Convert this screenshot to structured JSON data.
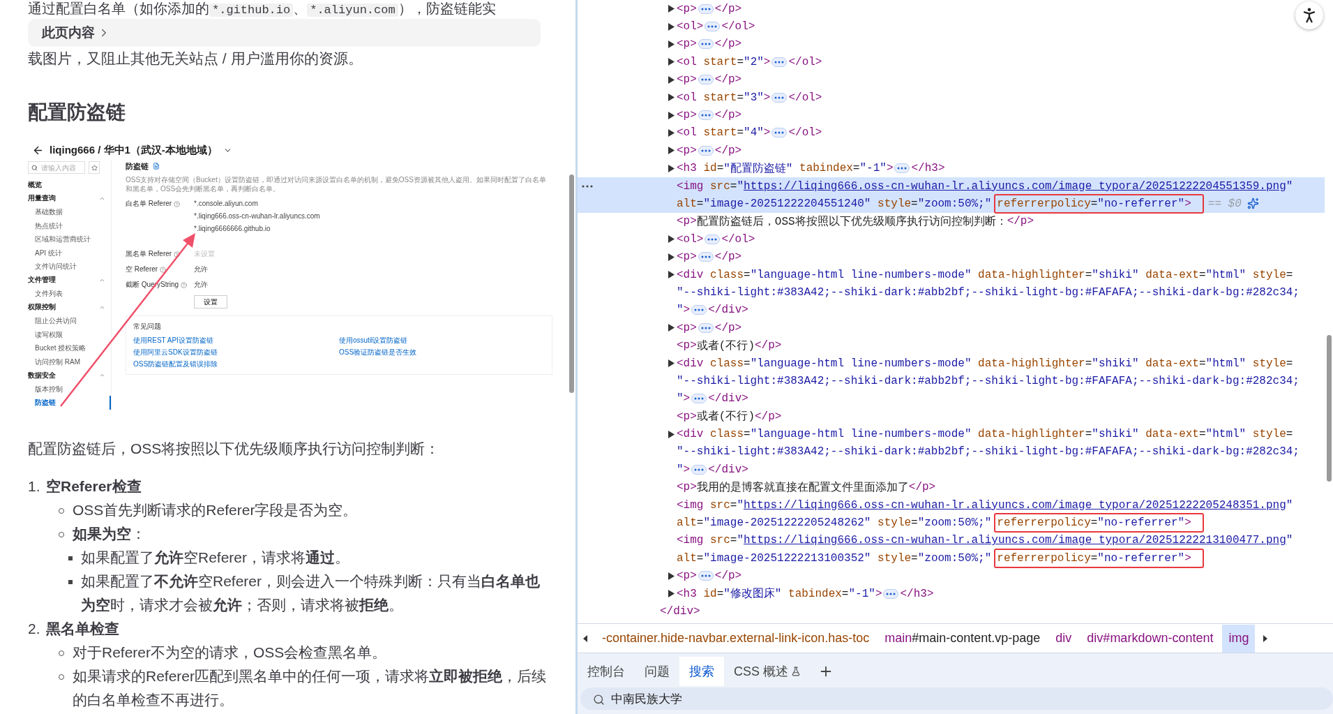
{
  "article": {
    "intro_cut": {
      "parts": [
        {
          "kind": "text",
          "t": "通过配置白名单（如你添加的"
        },
        {
          "kind": "code",
          "t": "*.github.io"
        },
        {
          "kind": "text",
          "t": "、"
        },
        {
          "kind": "code",
          "t": "*.aliyun.com"
        },
        {
          "kind": "text",
          "t": "），防盗链能实"
        }
      ]
    },
    "toc": "此页内容",
    "intro_end": "载图片，又阻止其他无关站点 / 用户滥用你的资源。",
    "heading": "配置防盗链",
    "screenshot": {
      "title": "liqing666 / 华中1（武汉-本地地域）",
      "search": {
        "placeholder": "请输入内容"
      },
      "nav": [
        {
          "kind": "link",
          "label": "概览"
        },
        {
          "kind": "group",
          "label": "用量查询",
          "expanded": true,
          "items": [
            {
              "label": "基础数据",
              "selected": false
            },
            {
              "label": "热点统计",
              "selected": false
            },
            {
              "label": "区域和运营商统计",
              "selected": false
            },
            {
              "label": "API 统计",
              "selected": false
            },
            {
              "label": "文件访问统计",
              "selected": false
            }
          ]
        },
        {
          "kind": "group",
          "label": "文件管理",
          "expanded": true,
          "items": [
            {
              "label": "文件列表",
              "selected": false
            }
          ]
        },
        {
          "kind": "group",
          "label": "权限控制",
          "expanded": true,
          "items": [
            {
              "label": "阻止公共访问",
              "selected": false
            },
            {
              "label": "读写权限",
              "selected": false
            },
            {
              "label": "Bucket 授权策略",
              "selected": false
            },
            {
              "label": "访问控制 RAM",
              "selected": false
            }
          ]
        },
        {
          "kind": "group",
          "label": "数据安全",
          "expanded": true,
          "items": [
            {
              "label": "版本控制",
              "selected": false
            },
            {
              "label": "防盗链",
              "selected": true
            }
          ]
        }
      ],
      "heading": "防盗链",
      "description": "OSS支持对存储空间（Bucket）设置防盗链，即通过对访问来源设置白名单的机制，避免OSS资源被其他人盗用。如果同时配置了白名单和黑名单，OSS会先判断黑名单，再判断白名单。",
      "fields": [
        {
          "label": "白名单 Referer",
          "muted": false,
          "values": [
            "*.console.aliyun.com",
            "*.liqing666.oss-cn-wuhan-lr.aliyuncs.com",
            "*.liqing6666666.github.io"
          ]
        },
        {
          "label": "黑名单 Referer",
          "muted": true,
          "values": [
            "未设置"
          ]
        },
        {
          "label": "空 Referer",
          "muted": false,
          "values": [
            "允许"
          ]
        },
        {
          "label": "截断 QueryString",
          "muted": false,
          "values": [
            "允许"
          ]
        }
      ],
      "button": "设置",
      "faq": {
        "title": "常见问题",
        "links": [
          "使用REST API设置防盗链",
          "使用ossutil设置防盗链",
          "使用阿里云SDK设置防盗链",
          "OSS验证防盗链是否生效",
          "OSS防盗链配置及错误排除"
        ]
      }
    },
    "paragraph": "配置防盗链后，OSS将按照以下优先级顺序执行访问控制判断：",
    "list": [
      {
        "number": "1.",
        "title": "空Referer检查",
        "children": [
          {
            "text": "OSS首先判断请求的Referer字段是否为空。"
          },
          {
            "text": "**如果为空**：",
            "children": [
              {
                "text": "如果配置了**允许**空Referer，请求将**通过**。"
              },
              {
                "text": "如果配置了**不允许**空Referer，则会进入一个特殊判断：只有当**白名单也为空**时，请求才会被**允许**；否则，请求将被**拒绝**。"
              }
            ]
          }
        ]
      },
      {
        "number": "2.",
        "title": "黑名单检查",
        "children": [
          {
            "text": "对于Referer不为空的请求，OSS会检查黑名单。"
          },
          {
            "text": "如果请求的Referer匹配到黑名单中的任何一项，请求将**立即被拒绝**，后续的白名单检查不再进行。"
          }
        ]
      }
    ]
  },
  "elements": {
    "nodes": [
      {
        "expandable": true,
        "selected": false,
        "lines": [
          [
            {
              "kind": "tag",
              "t": "<p>"
            },
            {
              "kind": "more"
            },
            {
              "kind": "tag",
              "t": "</p>"
            }
          ]
        ]
      },
      {
        "expandable": true,
        "selected": false,
        "lines": [
          [
            {
              "kind": "tag",
              "t": "<ol>"
            },
            {
              "kind": "more"
            },
            {
              "kind": "tag",
              "t": "</ol>"
            }
          ]
        ]
      },
      {
        "expandable": true,
        "selected": false,
        "lines": [
          [
            {
              "kind": "tag",
              "t": "<p>"
            },
            {
              "kind": "more"
            },
            {
              "kind": "tag",
              "t": "</p>"
            }
          ]
        ]
      },
      {
        "expandable": true,
        "selected": false,
        "lines": [
          [
            {
              "kind": "tag",
              "t": "<ol"
            },
            {
              "kind": "attr",
              "t": " start"
            },
            {
              "kind": "text",
              "t": "="
            },
            {
              "kind": "val",
              "t": "\"2\""
            },
            {
              "kind": "tag",
              "t": ">"
            },
            {
              "kind": "more"
            },
            {
              "kind": "tag",
              "t": "</ol>"
            }
          ]
        ]
      },
      {
        "expandable": true,
        "selected": false,
        "lines": [
          [
            {
              "kind": "tag",
              "t": "<p>"
            },
            {
              "kind": "more"
            },
            {
              "kind": "tag",
              "t": "</p>"
            }
          ]
        ]
      },
      {
        "expandable": true,
        "selected": false,
        "lines": [
          [
            {
              "kind": "tag",
              "t": "<ol"
            },
            {
              "kind": "attr",
              "t": " start"
            },
            {
              "kind": "text",
              "t": "="
            },
            {
              "kind": "val",
              "t": "\"3\""
            },
            {
              "kind": "tag",
              "t": ">"
            },
            {
              "kind": "more"
            },
            {
              "kind": "tag",
              "t": "</ol>"
            }
          ]
        ]
      },
      {
        "expandable": true,
        "selected": false,
        "lines": [
          [
            {
              "kind": "tag",
              "t": "<p>"
            },
            {
              "kind": "more"
            },
            {
              "kind": "tag",
              "t": "</p>"
            }
          ]
        ]
      },
      {
        "expandable": true,
        "selected": false,
        "lines": [
          [
            {
              "kind": "tag",
              "t": "<ol"
            },
            {
              "kind": "attr",
              "t": " start"
            },
            {
              "kind": "text",
              "t": "="
            },
            {
              "kind": "val",
              "t": "\"4\""
            },
            {
              "kind": "tag",
              "t": ">"
            },
            {
              "kind": "more"
            },
            {
              "kind": "tag",
              "t": "</ol>"
            }
          ]
        ]
      },
      {
        "expandable": true,
        "selected": false,
        "lines": [
          [
            {
              "kind": "tag",
              "t": "<p>"
            },
            {
              "kind": "more"
            },
            {
              "kind": "tag",
              "t": "</p>"
            }
          ]
        ]
      },
      {
        "expandable": true,
        "selected": false,
        "lines": [
          [
            {
              "kind": "tag",
              "t": "<h3"
            },
            {
              "kind": "attr",
              "t": " id"
            },
            {
              "kind": "text",
              "t": "="
            },
            {
              "kind": "val",
              "t": "\"配置防盗链\""
            },
            {
              "kind": "attr",
              "t": " tabindex"
            },
            {
              "kind": "text",
              "t": "="
            },
            {
              "kind": "val",
              "t": "\"-1\""
            },
            {
              "kind": "tag",
              "t": ">"
            },
            {
              "kind": "more"
            },
            {
              "kind": "tag",
              "t": "</h3>"
            }
          ]
        ]
      },
      {
        "expandable": false,
        "selected": true,
        "lines": [
          [
            {
              "kind": "tag",
              "t": "<img"
            },
            {
              "kind": "attr",
              "t": " src"
            },
            {
              "kind": "text",
              "t": "="
            },
            {
              "kind": "val",
              "t": "\""
            },
            {
              "kind": "link",
              "t": "https://liqing666.oss-cn-wuhan-lr.aliyuncs.com/image_typora/20251222204551359.png"
            },
            {
              "kind": "val",
              "t": "\""
            }
          ],
          [
            {
              "kind": "attr",
              "t": "alt"
            },
            {
              "kind": "text",
              "t": "="
            },
            {
              "kind": "val",
              "t": "\"image-20251222204551240\""
            },
            {
              "kind": "attr",
              "t": " style"
            },
            {
              "kind": "text",
              "t": "="
            },
            {
              "kind": "val",
              "t": "\"zoom:50%;\""
            },
            {
              "kind": "box",
              "parts": [
                {
                  "kind": "attr",
                  "t": "referrerpolicy"
                },
                {
                  "kind": "text",
                  "t": "="
                },
                {
                  "kind": "val",
                  "t": "\"no-referrer\""
                },
                {
                  "kind": "tag",
                  "t": ">"
                }
              ]
            },
            {
              "kind": "dim",
              "t": "== $0"
            },
            {
              "kind": "ai"
            }
          ]
        ]
      },
      {
        "expandable": false,
        "selected": false,
        "lines": [
          [
            {
              "kind": "tag",
              "t": "<p>"
            },
            {
              "kind": "text",
              "t": "配置防盗链后，OSS将按照以下优先级顺序执行访问控制判断："
            },
            {
              "kind": "tag",
              "t": "</p>"
            }
          ]
        ]
      },
      {
        "expandable": true,
        "selected": false,
        "lines": [
          [
            {
              "kind": "tag",
              "t": "<ol>"
            },
            {
              "kind": "more"
            },
            {
              "kind": "tag",
              "t": "</ol>"
            }
          ]
        ]
      },
      {
        "expandable": true,
        "selected": false,
        "lines": [
          [
            {
              "kind": "tag",
              "t": "<p>"
            },
            {
              "kind": "more"
            },
            {
              "kind": "tag",
              "t": "</p>"
            }
          ]
        ]
      },
      {
        "expandable": true,
        "selected": false,
        "lines": [
          [
            {
              "kind": "tag",
              "t": "<div"
            },
            {
              "kind": "attr",
              "t": " class"
            },
            {
              "kind": "text",
              "t": "="
            },
            {
              "kind": "val",
              "t": "\"language-html line-numbers-mode\""
            },
            {
              "kind": "attr",
              "t": " data-highlighter"
            },
            {
              "kind": "text",
              "t": "="
            },
            {
              "kind": "val",
              "t": "\"shiki\""
            },
            {
              "kind": "attr",
              "t": " data-ext"
            },
            {
              "kind": "text",
              "t": "="
            },
            {
              "kind": "val",
              "t": "\"html\""
            },
            {
              "kind": "attr",
              "t": " style"
            },
            {
              "kind": "text",
              "t": "="
            }
          ],
          [
            {
              "kind": "val",
              "t": "\"--shiki-light:#383A42;--shiki-dark:#abb2bf;--shiki-light-bg:#FAFAFA;--shiki-dark-bg:#282c34;"
            }
          ],
          [
            {
              "kind": "val",
              "t": "\""
            },
            {
              "kind": "tag",
              "t": ">"
            },
            {
              "kind": "more"
            },
            {
              "kind": "tag",
              "t": "</div>"
            }
          ]
        ]
      },
      {
        "expandable": true,
        "selected": false,
        "lines": [
          [
            {
              "kind": "tag",
              "t": "<p>"
            },
            {
              "kind": "more"
            },
            {
              "kind": "tag",
              "t": "</p>"
            }
          ]
        ]
      },
      {
        "expandable": false,
        "selected": false,
        "lines": [
          [
            {
              "kind": "tag",
              "t": "<p>"
            },
            {
              "kind": "text",
              "t": "或者(不行)"
            },
            {
              "kind": "tag",
              "t": "</p>"
            }
          ]
        ]
      },
      {
        "expandable": true,
        "selected": false,
        "lines": [
          [
            {
              "kind": "tag",
              "t": "<div"
            },
            {
              "kind": "attr",
              "t": " class"
            },
            {
              "kind": "text",
              "t": "="
            },
            {
              "kind": "val",
              "t": "\"language-html line-numbers-mode\""
            },
            {
              "kind": "attr",
              "t": " data-highlighter"
            },
            {
              "kind": "text",
              "t": "="
            },
            {
              "kind": "val",
              "t": "\"shiki\""
            },
            {
              "kind": "attr",
              "t": " data-ext"
            },
            {
              "kind": "text",
              "t": "="
            },
            {
              "kind": "val",
              "t": "\"html\""
            },
            {
              "kind": "attr",
              "t": " style"
            },
            {
              "kind": "text",
              "t": "="
            }
          ],
          [
            {
              "kind": "val",
              "t": "\"--shiki-light:#383A42;--shiki-dark:#abb2bf;--shiki-light-bg:#FAFAFA;--shiki-dark-bg:#282c34;"
            }
          ],
          [
            {
              "kind": "val",
              "t": "\""
            },
            {
              "kind": "tag",
              "t": ">"
            },
            {
              "kind": "more"
            },
            {
              "kind": "tag",
              "t": "</div>"
            }
          ]
        ]
      },
      {
        "expandable": false,
        "selected": false,
        "lines": [
          [
            {
              "kind": "tag",
              "t": "<p>"
            },
            {
              "kind": "text",
              "t": "或者(不行)"
            },
            {
              "kind": "tag",
              "t": "</p>"
            }
          ]
        ]
      },
      {
        "expandable": true,
        "selected": false,
        "lines": [
          [
            {
              "kind": "tag",
              "t": "<div"
            },
            {
              "kind": "attr",
              "t": " class"
            },
            {
              "kind": "text",
              "t": "="
            },
            {
              "kind": "val",
              "t": "\"language-html line-numbers-mode\""
            },
            {
              "kind": "attr",
              "t": " data-highlighter"
            },
            {
              "kind": "text",
              "t": "="
            },
            {
              "kind": "val",
              "t": "\"shiki\""
            },
            {
              "kind": "attr",
              "t": " data-ext"
            },
            {
              "kind": "text",
              "t": "="
            },
            {
              "kind": "val",
              "t": "\"html\""
            },
            {
              "kind": "attr",
              "t": " style"
            },
            {
              "kind": "text",
              "t": "="
            }
          ],
          [
            {
              "kind": "val",
              "t": "\"--shiki-light:#383A42;--shiki-dark:#abb2bf;--shiki-light-bg:#FAFAFA;--shiki-dark-bg:#282c34;"
            }
          ],
          [
            {
              "kind": "val",
              "t": "\""
            },
            {
              "kind": "tag",
              "t": ">"
            },
            {
              "kind": "more"
            },
            {
              "kind": "tag",
              "t": "</div>"
            }
          ]
        ]
      },
      {
        "expandable": false,
        "selected": false,
        "lines": [
          [
            {
              "kind": "tag",
              "t": "<p>"
            },
            {
              "kind": "text",
              "t": "我用的是博客就直接在配置文件里面添加了"
            },
            {
              "kind": "tag",
              "t": "</p>"
            }
          ]
        ]
      },
      {
        "expandable": false,
        "selected": false,
        "lines": [
          [
            {
              "kind": "tag",
              "t": "<img"
            },
            {
              "kind": "attr",
              "t": " src"
            },
            {
              "kind": "text",
              "t": "="
            },
            {
              "kind": "val",
              "t": "\""
            },
            {
              "kind": "link",
              "t": "https://liqing666.oss-cn-wuhan-lr.aliyuncs.com/image_typora/20251222205248351.png"
            },
            {
              "kind": "val",
              "t": "\""
            }
          ],
          [
            {
              "kind": "attr",
              "t": "alt"
            },
            {
              "kind": "text",
              "t": "="
            },
            {
              "kind": "val",
              "t": "\"image-20251222205248262\""
            },
            {
              "kind": "attr",
              "t": " style"
            },
            {
              "kind": "text",
              "t": "="
            },
            {
              "kind": "val",
              "t": "\"zoom:50%;\""
            },
            {
              "kind": "box",
              "parts": [
                {
                  "kind": "attr",
                  "t": "referrerpolicy"
                },
                {
                  "kind": "text",
                  "t": "="
                },
                {
                  "kind": "val",
                  "t": "\"no-referrer\""
                },
                {
                  "kind": "tag",
                  "t": ">"
                }
              ]
            }
          ]
        ]
      },
      {
        "expandable": false,
        "selected": false,
        "lines": [
          [
            {
              "kind": "tag",
              "t": "<img"
            },
            {
              "kind": "attr",
              "t": " src"
            },
            {
              "kind": "text",
              "t": "="
            },
            {
              "kind": "val",
              "t": "\""
            },
            {
              "kind": "link",
              "t": "https://liqing666.oss-cn-wuhan-lr.aliyuncs.com/image_typora/20251222213100477.png"
            },
            {
              "kind": "val",
              "t": "\""
            }
          ],
          [
            {
              "kind": "attr",
              "t": "alt"
            },
            {
              "kind": "text",
              "t": "="
            },
            {
              "kind": "val",
              "t": "\"image-20251222213100352\""
            },
            {
              "kind": "attr",
              "t": " style"
            },
            {
              "kind": "text",
              "t": "="
            },
            {
              "kind": "val",
              "t": "\"zoom:50%;\""
            },
            {
              "kind": "box",
              "parts": [
                {
                  "kind": "attr",
                  "t": "referrerpolicy"
                },
                {
                  "kind": "text",
                  "t": "="
                },
                {
                  "kind": "val",
                  "t": "\"no-referrer\""
                },
                {
                  "kind": "tag",
                  "t": ">"
                }
              ]
            }
          ]
        ]
      },
      {
        "expandable": true,
        "selected": false,
        "lines": [
          [
            {
              "kind": "tag",
              "t": "<p>"
            },
            {
              "kind": "more"
            },
            {
              "kind": "tag",
              "t": "</p>"
            }
          ]
        ]
      },
      {
        "expandable": true,
        "selected": false,
        "lines": [
          [
            {
              "kind": "tag",
              "t": "<h3"
            },
            {
              "kind": "attr",
              "t": " id"
            },
            {
              "kind": "text",
              "t": "="
            },
            {
              "kind": "val",
              "t": "\"修改图床\""
            },
            {
              "kind": "attr",
              "t": " tabindex"
            },
            {
              "kind": "text",
              "t": "="
            },
            {
              "kind": "val",
              "t": "\"-1\""
            },
            {
              "kind": "tag",
              "t": ">"
            },
            {
              "kind": "more"
            },
            {
              "kind": "tag",
              "t": "</h3>"
            }
          ]
        ]
      }
    ],
    "closing": [
      {
        "kind": "tag",
        "t": "</div>"
      }
    ]
  },
  "breadcrumb": [
    {
      "selected": false,
      "parts": [
        {
          "kind": "attr",
          "t": "-container.hide-navbar.external-link-icon.has-toc"
        }
      ]
    },
    {
      "selected": false,
      "parts": [
        {
          "kind": "tag",
          "t": "main"
        },
        {
          "kind": "text",
          "t": "#main-content.vp-page"
        }
      ]
    },
    {
      "selected": false,
      "parts": [
        {
          "kind": "tag",
          "t": "div"
        }
      ]
    },
    {
      "selected": false,
      "parts": [
        {
          "kind": "tag",
          "t": "div#markdown-content"
        }
      ]
    },
    {
      "selected": true,
      "parts": [
        {
          "kind": "tag",
          "t": "img"
        }
      ]
    }
  ],
  "drawer_tabs": [
    {
      "label": "控制台",
      "selected": false,
      "experimental": false
    },
    {
      "label": "问题",
      "selected": false,
      "experimental": false
    },
    {
      "label": "搜索",
      "selected": true,
      "experimental": false
    },
    {
      "label": "CSS 概述",
      "selected": false,
      "experimental": true
    }
  ],
  "search": {
    "value": "中南民族大学"
  }
}
